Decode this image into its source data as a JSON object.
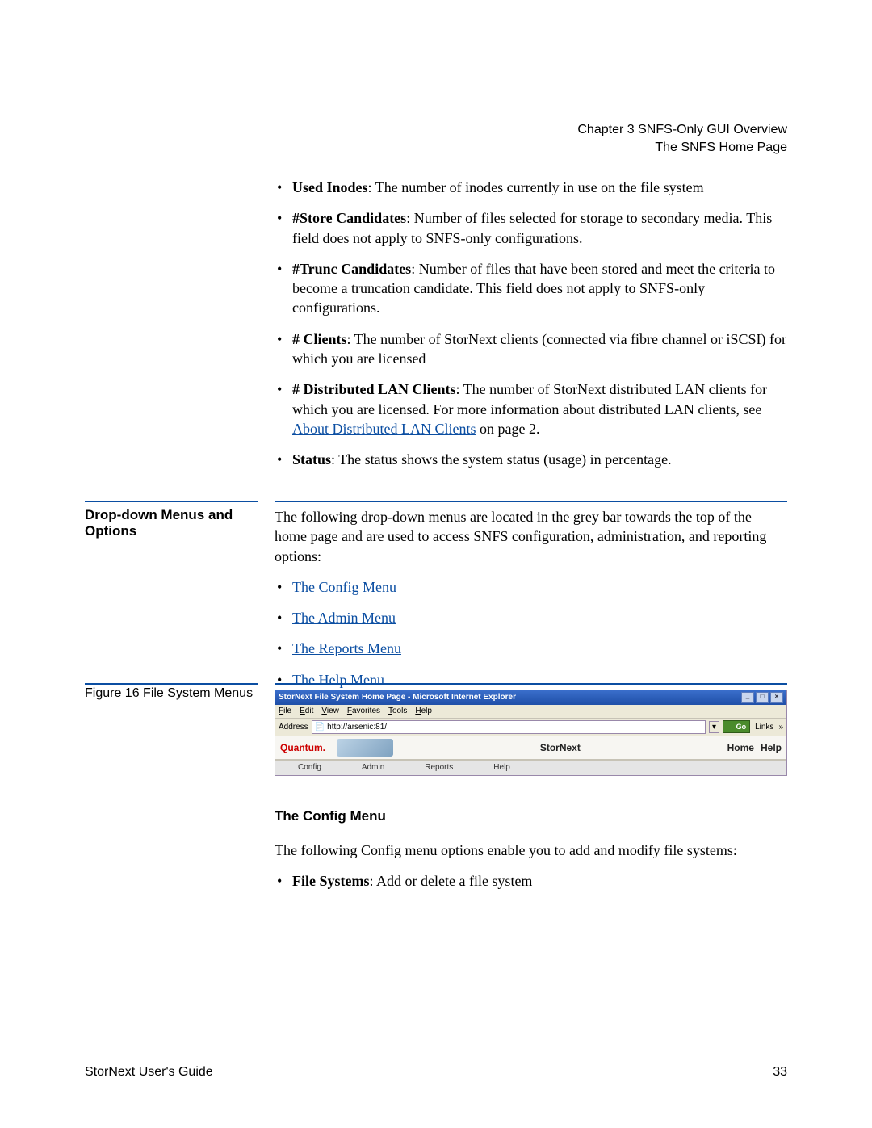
{
  "header": {
    "chapter": "Chapter 3  SNFS-Only GUI Overview",
    "section": "The SNFS Home Page"
  },
  "bullets1": [
    {
      "term": "Used Inodes",
      "text": ": The number of inodes currently in use on the file system"
    },
    {
      "term": "#Store Candidates",
      "text": ": Number of files selected for storage to secondary media. This field does not apply to SNFS-only configurations."
    },
    {
      "term": "#Trunc Candidates",
      "text": ": Number of files that have been stored and meet the criteria to become a truncation candidate. This field does not apply to SNFS-only configurations."
    },
    {
      "term": "# Clients",
      "text": ": The number of StorNext clients (connected via fibre channel or iSCSI) for which you are licensed"
    },
    {
      "term": "# Distributed LAN Clients",
      "text_pre": ": The number of StorNext distributed LAN clients for which you are licensed. For more information about distributed LAN clients, see ",
      "link": "About Distributed LAN Clients",
      "text_post": " on page  2."
    },
    {
      "term": "Status",
      "text": ": The status shows the system status (usage) in percentage."
    }
  ],
  "dropdown": {
    "title": "Drop-down Menus and Options",
    "intro": "The following drop-down menus are located in the grey bar towards the top of the home page and are used to access SNFS configuration, administration, and reporting options:",
    "links": [
      "The Config Menu",
      "The Admin Menu",
      "The Reports Menu",
      "The Help Menu"
    ]
  },
  "figure": {
    "caption": "Figure 16  File System Menus"
  },
  "screenshot": {
    "title": "StorNext File System Home Page - Microsoft Internet Explorer",
    "menus": [
      "File",
      "Edit",
      "View",
      "Favorites",
      "Tools",
      "Help"
    ],
    "address_label": "Address",
    "address_value": "http://arsenic:81/",
    "go": "Go",
    "links_label": "Links",
    "brand_left": "Quantum.",
    "brand_center": "StorNext",
    "brand_right": [
      "Home",
      "Help"
    ],
    "tabs": [
      "Config",
      "Admin",
      "Reports",
      "Help"
    ]
  },
  "config": {
    "heading": "The Config Menu",
    "intro": "The following Config menu options enable you to add and modify file systems:",
    "item_term": "File Systems",
    "item_text": ": Add or delete a file system"
  },
  "footer": {
    "left": "StorNext User's Guide",
    "right": "33"
  }
}
